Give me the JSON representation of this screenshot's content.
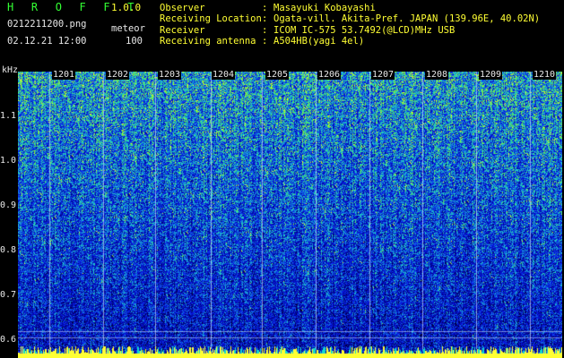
{
  "app": {
    "title": "H R O F F T",
    "version": "1.0.0"
  },
  "file": {
    "name": "0212211200.png",
    "mode": "meteor",
    "datetime": "02.12.21 12:00",
    "count": "100"
  },
  "info": [
    {
      "label": "Observer",
      "value": "Masayuki Kobayashi"
    },
    {
      "label": "Receiving Location",
      "value": "Ogata-vill. Akita-Pref. JAPAN (139.96E, 40.02N)"
    },
    {
      "label": "Receiver",
      "value": "ICOM IC-575 53.7492(@LCD)MHz USB"
    },
    {
      "label": "Receiving antenna",
      "value": "A504HB(yagi 4el)"
    }
  ],
  "colon": ":",
  "axis": {
    "y_unit": "kHz",
    "y_ticks": [
      "1.1",
      "1.0",
      "0.9",
      "0.8",
      "0.7",
      "0.6"
    ],
    "x_ticks": [
      "1201",
      "1202",
      "1203",
      "1204",
      "1205",
      "1206",
      "1207",
      "1208",
      "1209",
      "1210"
    ]
  },
  "colors": {
    "green": "#33ff33",
    "yellow": "#ffff33",
    "deep_blue": "#0818a0",
    "cyan": "#10d8d0"
  }
}
